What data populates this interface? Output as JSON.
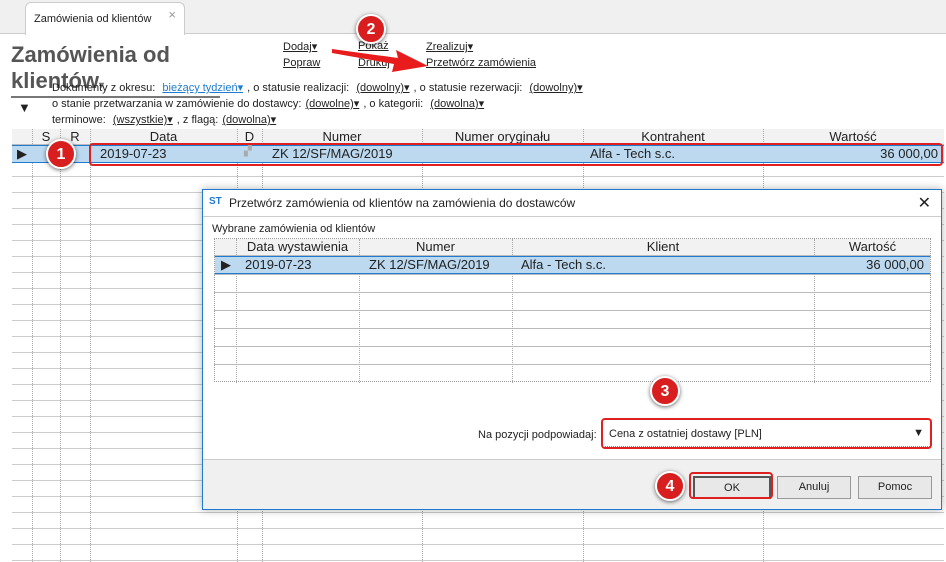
{
  "tab": {
    "label": "Zamówienia od klientów",
    "close": "×"
  },
  "page_title": "Zamówienia od klientów",
  "actions": {
    "dodaj": "Dodaj",
    "popraw": "Popraw",
    "pokaz": "Pokaż",
    "drukuj": "Drukuj",
    "zrealizuj": "Zrealizuj",
    "przetworz": "Przetwórz zamówienia"
  },
  "filters": {
    "okres_label": "Dokumenty z okresu:",
    "okres_value": "bieżący tydzień",
    "realizacja_label": ", o statusie realizacji:",
    "realizacja_value": "(dowolny)",
    "rezerwacja_label": ", o statusie rezerwacji:",
    "rezerwacja_value": "(dowolny)",
    "przetwarzanie_label": "o stanie przetwarzania w zamówienie do dostawcy:",
    "przetwarzanie_value": "(dowolne)",
    "kategoria_label": ", o kategorii:",
    "kategoria_value": "(dowolna)",
    "terminowe_label": "terminowe:",
    "terminowe_value": "(wszystkie)",
    "flaga_label": ", z flagą:",
    "flaga_value": "(dowolna)"
  },
  "grid": {
    "columns": [
      "S",
      "R",
      "Data",
      "D",
      "Numer",
      "Numer oryginału",
      "Kontrahent",
      "Wartość"
    ],
    "rows": [
      {
        "data": "2019-07-23",
        "numer": "ZK 12/SF/MAG/2019",
        "numer_oryginalu": "",
        "kontrahent": "Alfa - Tech s.c.",
        "wartosc": "36 000,00"
      }
    ]
  },
  "dialog": {
    "title": "Przetwórz zamówienia od klientów na zamówienia do dostawców",
    "section_label": "Wybrane zamówienia od klientów",
    "columns": [
      "Data wystawienia",
      "Numer",
      "Klient",
      "Wartość"
    ],
    "rows": [
      {
        "data": "2019-07-23",
        "numer": "ZK 12/SF/MAG/2019",
        "klient": "Alfa - Tech s.c.",
        "wartosc": "36 000,00"
      }
    ],
    "hint_label": "Na pozycji podpowiadaj:",
    "hint_value": "Cena z ostatniej dostawy [PLN]",
    "ok": "OK",
    "cancel": "Anuluj",
    "help": "Pomoc"
  },
  "badges": [
    "1",
    "2",
    "3",
    "4"
  ],
  "colors": {
    "accent": "#1e7bd0",
    "selection": "#bcd9f0",
    "annotation": "#d81e1e"
  }
}
